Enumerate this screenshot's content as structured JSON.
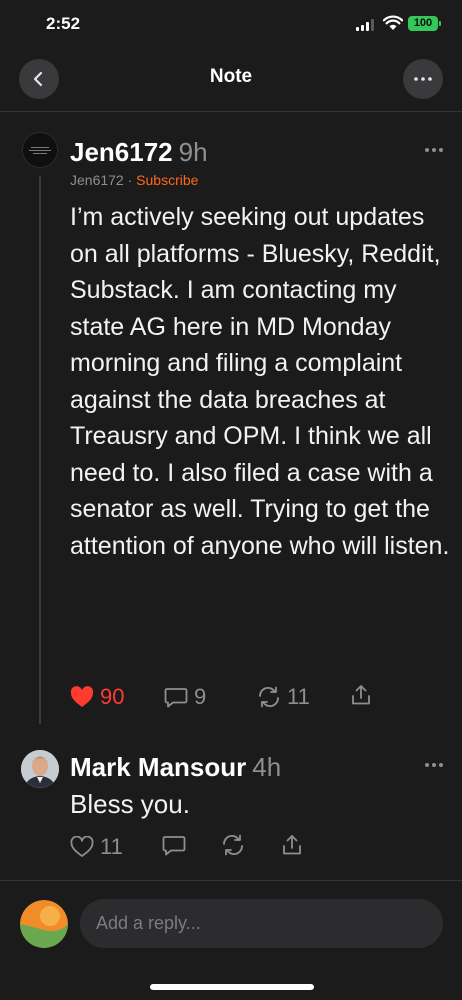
{
  "status_bar": {
    "time": "2:52",
    "battery": "100",
    "battery_color": "#35c759"
  },
  "nav": {
    "title": "Note",
    "back_icon": "chevron-left-icon",
    "more_icon": "ellipsis-icon"
  },
  "note": {
    "author": "Jen6172",
    "time": "9h",
    "handle": "Jen6172",
    "separator": "·",
    "subscribe_label": "Subscribe",
    "subscribe_color": "#ff6719",
    "body": "I’m actively seeking out updates on all platforms - Bluesky, Reddit, Substack. I am contacting my state AG here in MD Monday morning and filing a complaint against the data breaches at Treausry and OPM. I think we all need to. I also filed a case with a senator as well. Trying to get the attention of anyone who will listen.",
    "likes": "90",
    "like_color": "#ff3b30",
    "comments": "9",
    "restacks": "11"
  },
  "reply": {
    "author": "Mark Mansour",
    "time": "4h",
    "body": "Bless you.",
    "likes": "11"
  },
  "composer": {
    "placeholder": "Add a reply..."
  }
}
